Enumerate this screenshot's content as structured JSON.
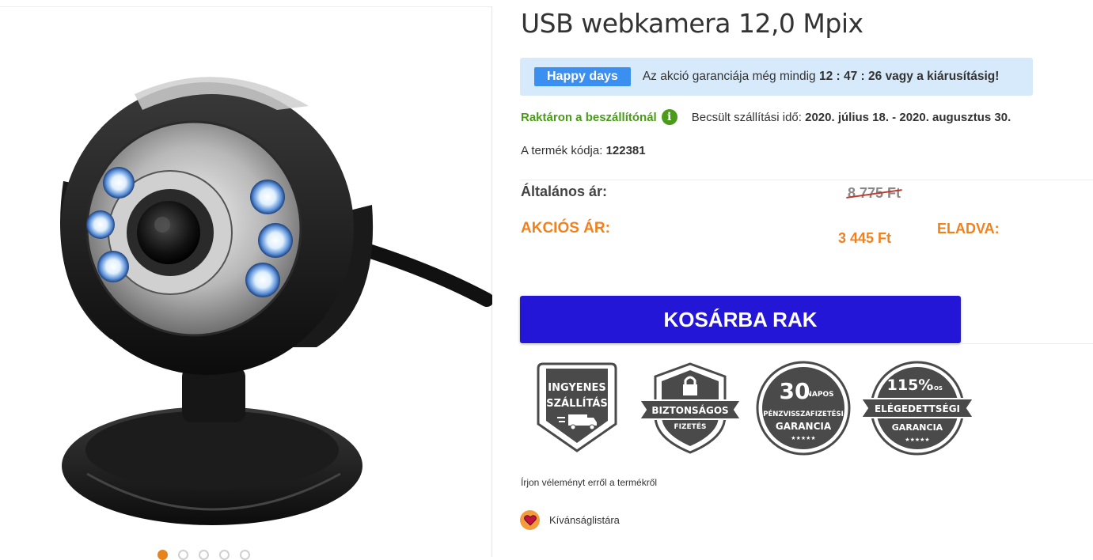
{
  "product": {
    "title": "USB webkamera 12,0 Mpix",
    "gallery_dots": 5,
    "gallery_active": 0
  },
  "promo": {
    "badge": "Happy days",
    "text_before": "Az akció garanciája még mindig",
    "countdown": "12 : 47 : 26",
    "text_after": "vagy a kiárusításig!"
  },
  "availability": {
    "stock": "Raktáron a beszállítónál",
    "shipping_label": "Becsült szállítási idő:",
    "shipping_dates": "2020. július 18. - 2020. augusztus 30."
  },
  "code": {
    "label": "A termék kódja:",
    "value": "122381"
  },
  "pricing": {
    "general_label": "Általános ár:",
    "general_price": "8 775 Ft",
    "sale_label": "AKCIÓS ÁR:",
    "sale_price": "3 445 Ft",
    "sold_label": "ELADVA:"
  },
  "cart": {
    "button": "KOSÁRBA RAK"
  },
  "trust_badges": [
    {
      "lines": [
        "INGYENES",
        "SZÁLLÍTÁS"
      ],
      "icon": "truck-icon"
    },
    {
      "lines": [
        "BIZTONSÁGOS",
        "FIZETÉS"
      ],
      "icon": "lock-icon"
    },
    {
      "big": "30",
      "small": "NAPOS",
      "lines": [
        "PÉNZVISSZAFIZETÉSI",
        "GARANCIA"
      ],
      "stars": "★★★★★"
    },
    {
      "big": "115%",
      "small": "-OS",
      "lines": [
        "ELÉGEDETTSÉGI",
        "GARANCIA"
      ],
      "stars": "★★★★★"
    }
  ],
  "links": {
    "review": "Írjon véleményt erről a termékről",
    "wishlist": "Kívánságlistára"
  },
  "colors": {
    "cart_button": "#2416d6",
    "sale": "#f0821e",
    "stock": "#4a9b1a",
    "promo_bg": "#d7eafb",
    "badge_bg": "#3b8ff0"
  }
}
